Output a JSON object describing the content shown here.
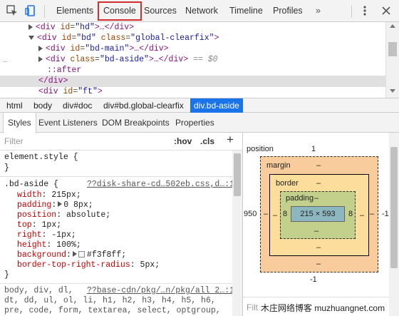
{
  "toolbar": {
    "tabs": [
      "Elements",
      "Console",
      "Sources",
      "Network",
      "Timeline",
      "Profiles"
    ],
    "active_tab": "Console",
    "overflow_label": "»"
  },
  "dom_lines": {
    "l1": {
      "open": "<div",
      "attr": "id",
      "val": "\"hd\"",
      "rest": ">…</div>"
    },
    "l2": {
      "open": "<div",
      "attr1": "id",
      "val1": "\"bd\"",
      "attr2": "class",
      "val2": "\"global-clearfix\"",
      "rest": ">"
    },
    "l3": {
      "open": "<div",
      "attr": "id",
      "val": "\"bd-main\"",
      "rest": ">…</div>"
    },
    "l4": {
      "open": "<div",
      "attr": "class",
      "val": "\"bd-aside\"",
      "rest": ">…</div>",
      "marker": "== $0",
      "dots": "…"
    },
    "l5": {
      "text": "::after"
    },
    "l6": {
      "text": "</div>"
    },
    "l7": {
      "open": "<div",
      "attr": "id",
      "val": "\"ft\"",
      "rest": ">"
    }
  },
  "breadcrumbs": [
    "html",
    "body",
    "div#doc",
    "div#bd.global-clearfix",
    "div.bd-aside"
  ],
  "subtabs": [
    "Styles",
    "Event Listeners",
    "DOM Breakpoints",
    "Properties"
  ],
  "filter": {
    "placeholder": "Filter",
    "hov": ":hov",
    "cls": ".cls",
    "plus": "+"
  },
  "rules": {
    "element_style": {
      "selector": "element.style {",
      "close": "}"
    },
    "aside": {
      "selector": ".bd-aside {",
      "source": "??disk-share-cd…502eb.css,d…:1",
      "props": [
        {
          "name": "width",
          "value": "215px;"
        },
        {
          "name": "padding",
          "value": "0 8px;"
        },
        {
          "name": "position",
          "value": "absolute;"
        },
        {
          "name": "top",
          "value": "1px;"
        },
        {
          "name": "right",
          "value": "-1px;"
        },
        {
          "name": "height",
          "value": "100%;"
        },
        {
          "name": "background",
          "value": "#f3f8ff;"
        },
        {
          "name": "border-top-right-radius",
          "value": "5px;"
        }
      ],
      "close": "}"
    },
    "base": {
      "line1": "body, div, dl,",
      "source": "??base-cdn/pkg/…n/pkg/all 2…:1",
      "line2": "dt, dd, ul, ol, li, h1, h2, h3, h4, h5, h6,",
      "line3": "pre, code, form, textarea, select, optgroup,"
    }
  },
  "boxmodel": {
    "position_label": "position",
    "position_top": "1",
    "margin_label": "margin",
    "margin_val": "–",
    "border_label": "border",
    "border_val": "–",
    "padding_label": "padding",
    "padding_val": "–",
    "content": "215 × 593",
    "pad_left": "8",
    "pad_right": "8",
    "left_pos": "950",
    "right_pos": "-1",
    "bottom_pos": "-1",
    "dash": "–",
    "filter_placeholder": "Filte"
  },
  "watermark": "木庄网络博客 muzhuangnet.com",
  "colors": {
    "swatch": "#f3f8ff",
    "accent": "#1a73e8",
    "active_outline": "#d32f2f"
  }
}
